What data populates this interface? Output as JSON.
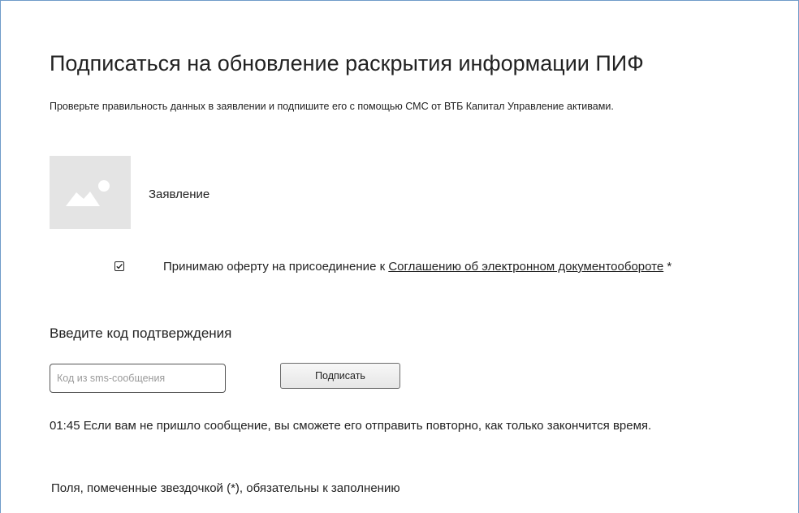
{
  "page": {
    "title": "Подписаться на обновление раскрытия информации ПИФ",
    "subtitle": "Проверьте правильность данных в заявлении и подпишите его с помощью СМС от ВТБ Капитал Управление активами."
  },
  "document": {
    "icon": "image-placeholder-icon",
    "label": "Заявление"
  },
  "agreement": {
    "checked": true,
    "text_before": "Принимаю оферту на присоединение к ",
    "link_text": "Соглашению об электронном документообороте",
    "required_mark": " *"
  },
  "confirmation": {
    "heading": "Введите код подтверждения",
    "input_placeholder": "Код из sms-сообщения",
    "input_value": "",
    "submit_label": "Подписать"
  },
  "timer": {
    "time": "01:45",
    "message": " Если вам не пришло сообщение, вы сможете его отправить повторно, как только закончится время."
  },
  "footer": {
    "required_note": "Поля, помеченные звездочкой (*), обязательны к заполнению"
  },
  "colors": {
    "frame_border": "#6f9cc9",
    "thumb_bg": "#e4e4e4",
    "thumb_icon": "#ffffff"
  }
}
